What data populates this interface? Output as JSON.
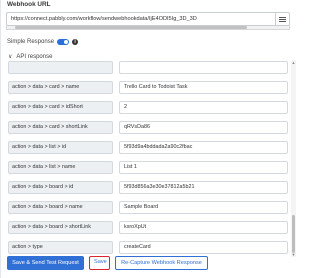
{
  "webhook": {
    "label": "Webhook URL",
    "url": "https://connect.pabbly.com/workflow/sendwebhookdata/IjE4ODI5Ig_3D_3D"
  },
  "simple_response": {
    "label": "Simple Response",
    "enabled": true
  },
  "api_response": {
    "label": "API response"
  },
  "rows": [
    {
      "key": "",
      "value": ""
    },
    {
      "key": "action > data > card > name",
      "value": "Trello Card to Todoist Task"
    },
    {
      "key": "action > data > card > idShort",
      "value": "2"
    },
    {
      "key": "action > data > card > shortLink",
      "value": "qRVsDa86"
    },
    {
      "key": "action > data > list > id",
      "value": "5f93d9a4bddada2a90c2fbac"
    },
    {
      "key": "action > data > list > name",
      "value": "List 1"
    },
    {
      "key": "action > data > board > id",
      "value": "5f93d856a3e30e37812a5b21"
    },
    {
      "key": "action > data > board > name",
      "value": "Sample Board"
    },
    {
      "key": "action > data > board > shortLink",
      "value": "ksroXpUt"
    },
    {
      "key": "action > type",
      "value": "createCard"
    }
  ],
  "buttons": {
    "save_send": "Save & Send Test Request",
    "save": "Save",
    "recapture": "Re-Capture Webhook Response"
  },
  "colors": {
    "primary": "#2f6fd6",
    "save_highlight": "#d9262c",
    "key_bg": "#edf0f3"
  }
}
